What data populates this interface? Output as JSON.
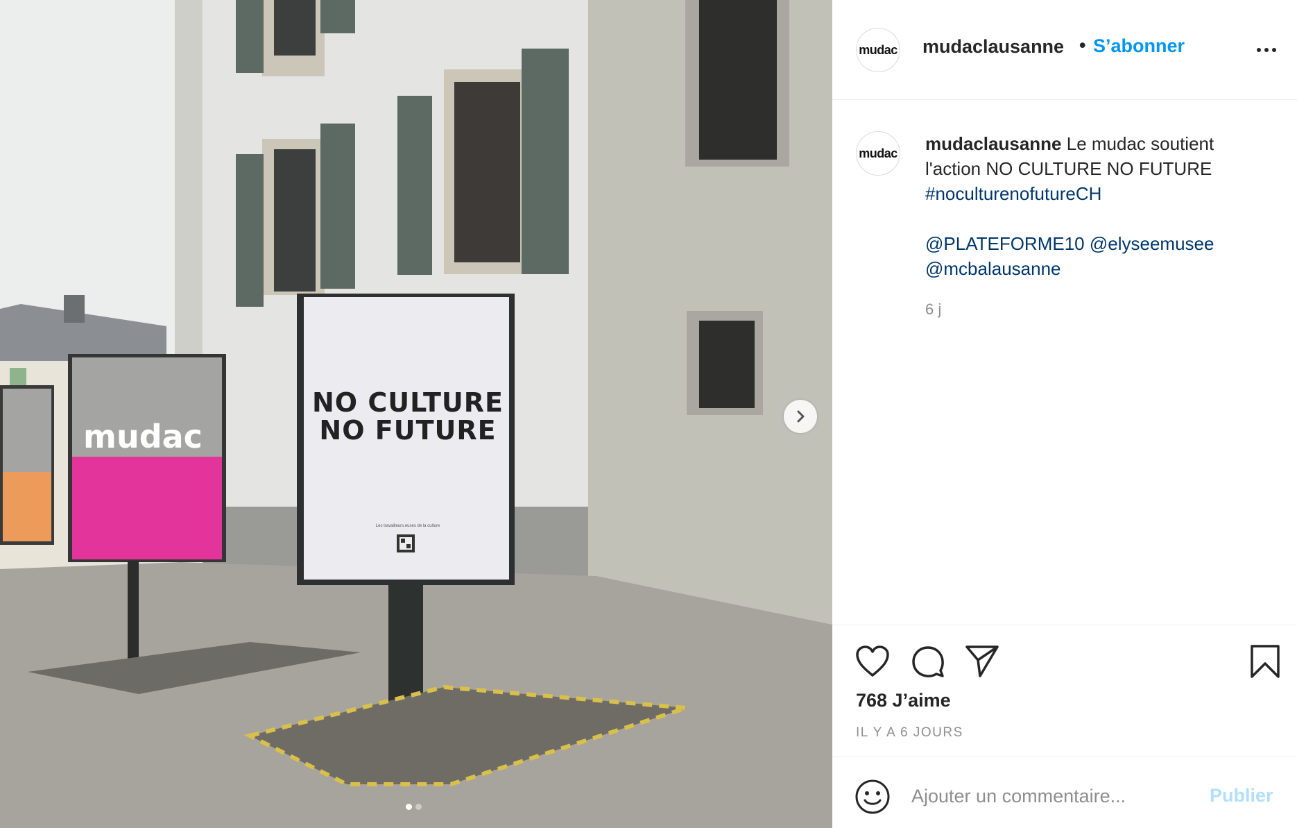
{
  "post": {
    "photo": {
      "poster_line1": "NO CULTURE",
      "poster_line2": "NO FUTURE",
      "poster_small": "Les travailleurs.euses de la culture",
      "image_count": 2,
      "active_index": 0
    },
    "header": {
      "avatar_text": "mudac",
      "username": "mudaclausanne",
      "separator": "•",
      "follow_label": "S’abonner"
    },
    "caption": {
      "avatar_text": "mudac",
      "username": "mudaclausanne",
      "text": "Le mudac soutient l'action NO CULTURE NO FUTURE",
      "hashtag": "#noculturenofutureCH",
      "mentions": [
        "@PLATEFORME10",
        "@elyseemusee",
        "@mcbalausanne"
      ],
      "time": "6 j"
    },
    "actions": {
      "likes": "768 J’aime",
      "date": "IL Y A 6 JOURS"
    },
    "comment": {
      "placeholder": "Ajouter un commentaire...",
      "publish_label": "Publier"
    }
  },
  "colors": {
    "accent": "#0095f6",
    "publish_disabled": "#b2dffc",
    "link": "#00376b",
    "muted": "#8e8e8e"
  }
}
